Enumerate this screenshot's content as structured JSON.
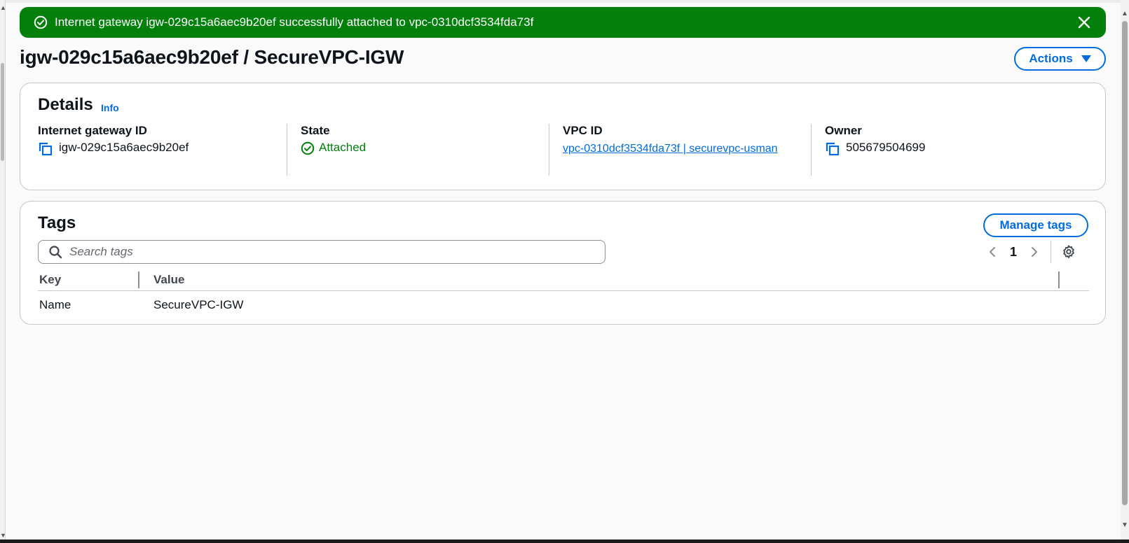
{
  "flash": {
    "message": "Internet gateway igw-029c15a6aec9b20ef successfully attached to vpc-0310dcf3534fda73f",
    "type": "success",
    "icons": {
      "status": "check-circle-icon",
      "dismiss": "close-icon"
    }
  },
  "header": {
    "title": "igw-029c15a6aec9b20ef / SecureVPC-IGW",
    "actions_label": "Actions"
  },
  "details": {
    "heading": "Details",
    "info_label": "Info",
    "fields": {
      "igw_id": {
        "label": "Internet gateway ID",
        "value": "igw-029c15a6aec9b20ef"
      },
      "state": {
        "label": "State",
        "value": "Attached"
      },
      "vpc_id": {
        "label": "VPC ID",
        "value": "vpc-0310dcf3534fda73f | securevpc-usman"
      },
      "owner": {
        "label": "Owner",
        "value": "505679504699"
      }
    }
  },
  "tags": {
    "heading": "Tags",
    "manage_label": "Manage tags",
    "search_placeholder": "Search tags",
    "search_value": "",
    "page": "1",
    "columns": {
      "key": "Key",
      "value": "Value"
    },
    "rows": [
      {
        "key": "Name",
        "value": "SecureVPC-IGW"
      }
    ]
  },
  "colors": {
    "success": "#037f0c",
    "link": "#006ce0",
    "text": "#0f141a",
    "border": "#c6c6cd"
  }
}
